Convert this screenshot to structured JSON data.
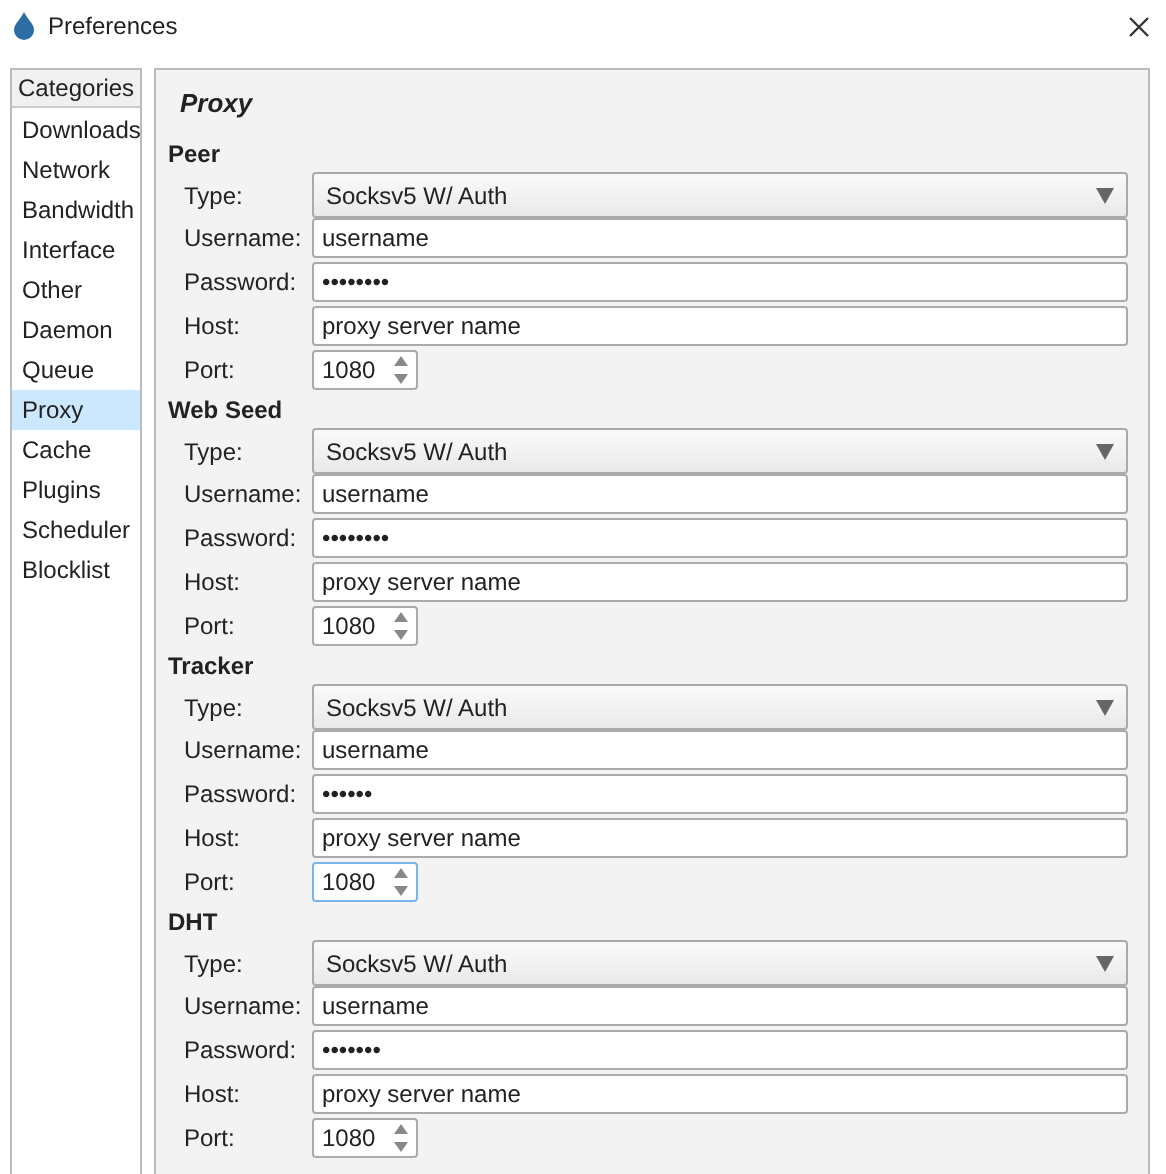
{
  "window": {
    "title": "Preferences"
  },
  "sidebar": {
    "header": "Categories",
    "items": [
      {
        "label": "Downloads",
        "selected": false
      },
      {
        "label": "Network",
        "selected": false
      },
      {
        "label": "Bandwidth",
        "selected": false
      },
      {
        "label": "Interface",
        "selected": false
      },
      {
        "label": "Other",
        "selected": false
      },
      {
        "label": "Daemon",
        "selected": false
      },
      {
        "label": "Queue",
        "selected": false
      },
      {
        "label": "Proxy",
        "selected": true
      },
      {
        "label": "Cache",
        "selected": false
      },
      {
        "label": "Plugins",
        "selected": false
      },
      {
        "label": "Scheduler",
        "selected": false
      },
      {
        "label": "Blocklist",
        "selected": false
      }
    ]
  },
  "page_title": "Proxy",
  "sections": [
    {
      "title": "Peer",
      "type_label": "Type:",
      "type": "Socksv5 W/ Auth",
      "username_label": "Username:",
      "username": "username",
      "password_label": "Password:",
      "password": "••••••••",
      "host_label": "Host:",
      "host": "proxy server name",
      "port_label": "Port:",
      "port": "1080",
      "port_focused": false
    },
    {
      "title": "Web Seed",
      "type_label": "Type:",
      "type": "Socksv5 W/ Auth",
      "username_label": "Username:",
      "username": "username",
      "password_label": "Password:",
      "password": "••••••••",
      "host_label": "Host:",
      "host": "proxy server name",
      "port_label": "Port:",
      "port": "1080",
      "port_focused": false
    },
    {
      "title": "Tracker",
      "type_label": "Type:",
      "type": "Socksv5 W/ Auth",
      "username_label": "Username:",
      "username": "username",
      "password_label": "Password:",
      "password": "••••••",
      "host_label": "Host:",
      "host": "proxy server name",
      "port_label": "Port:",
      "port": "1080",
      "port_focused": true
    },
    {
      "title": "DHT",
      "type_label": "Type:",
      "type": "Socksv5 W/ Auth",
      "username_label": "Username:",
      "username": "username",
      "password_label": "Password:",
      "password": "•••••••",
      "host_label": "Host:",
      "host": "proxy server name",
      "port_label": "Port:",
      "port": "1080",
      "port_focused": false
    }
  ]
}
